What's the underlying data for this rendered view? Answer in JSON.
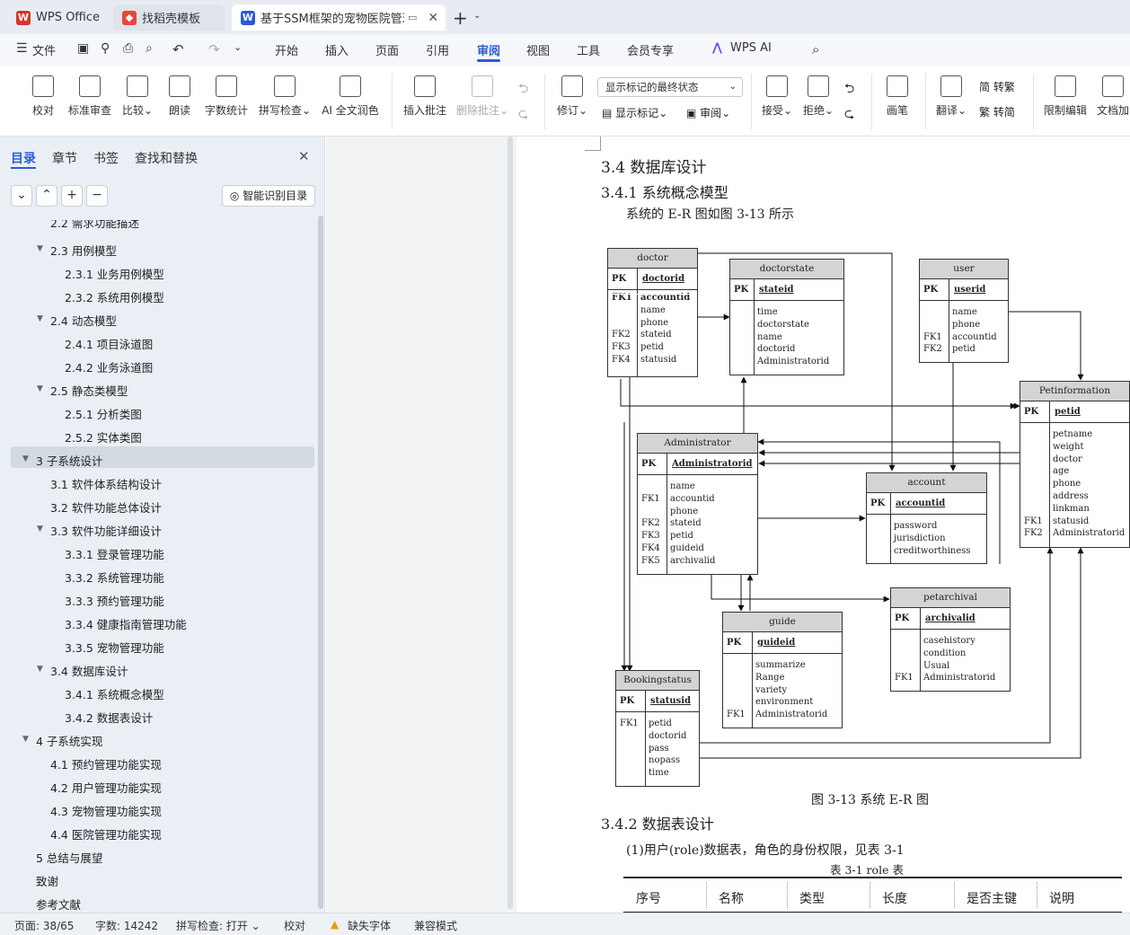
{
  "tabs": [
    {
      "label": "WPS Office"
    },
    {
      "label": "找稻壳模板"
    },
    {
      "label": "基于SSM框架的宠物医院管理"
    }
  ],
  "menu": [
    "文件",
    "开始",
    "插入",
    "页面",
    "引用",
    "审阅",
    "视图",
    "工具",
    "会员专享",
    "WPS AI"
  ],
  "active_menu": "审阅",
  "ribbon": {
    "proofread": "校对",
    "std_review": "标准审查",
    "compare": "比较",
    "read_aloud": "朗读",
    "word_count": "字数统计",
    "spell": "拼写检查",
    "ai_polish": "AI 全文润色",
    "insert_comment": "插入批注",
    "delete_comment": "删除批注",
    "track": "修订",
    "show_mode": "显示标记的最终状态",
    "show_marks": "显示标记",
    "review": "审阅",
    "accept": "接受",
    "reject": "拒绝",
    "pen": "画笔",
    "translate": "翻译",
    "to_trad": "简 转繁",
    "to_simp": "繁 转简",
    "restrict": "限制编辑",
    "doc_enc": "文档加"
  },
  "nav": {
    "tabs": [
      "目录",
      "章节",
      "书签",
      "查找和替换"
    ],
    "smart_btn": "智能识别目录",
    "items": [
      {
        "text": "2.2  需求功能描述",
        "level": 1
      },
      {
        "text": "2.3  用例模型",
        "level": 1,
        "expand": true
      },
      {
        "text": "2.3.1  业务用例模型",
        "level": 2
      },
      {
        "text": "2.3.2  系统用例模型",
        "level": 2
      },
      {
        "text": "2.4  动态模型",
        "level": 1,
        "expand": true
      },
      {
        "text": "2.4.1  项目泳道图",
        "level": 2
      },
      {
        "text": "2.4.2  业务泳道图",
        "level": 2
      },
      {
        "text": "2.5  静态类模型",
        "level": 1,
        "expand": true
      },
      {
        "text": "2.5.1  分析类图",
        "level": 2
      },
      {
        "text": "2.5.2  实体类图",
        "level": 2
      },
      {
        "text": "3  子系统设计",
        "level": 0,
        "expand": true,
        "selected": true
      },
      {
        "text": "3.1  软件体系结构设计",
        "level": 1
      },
      {
        "text": "3.2  软件功能总体设计",
        "level": 1
      },
      {
        "text": "3.3  软件功能详细设计",
        "level": 1,
        "expand": true
      },
      {
        "text": "3.3.1  登录管理功能",
        "level": 2
      },
      {
        "text": "3.3.2  系统管理功能",
        "level": 2
      },
      {
        "text": "3.3.3  预约管理功能",
        "level": 2
      },
      {
        "text": "3.3.4  健康指南管理功能",
        "level": 2
      },
      {
        "text": "3.3.5  宠物管理功能",
        "level": 2
      },
      {
        "text": "3.4  数据库设计",
        "level": 1,
        "expand": true
      },
      {
        "text": "3.4.1  系统概念模型",
        "level": 2
      },
      {
        "text": "3.4.2  数据表设计",
        "level": 2
      },
      {
        "text": "4  子系统实现",
        "level": 0,
        "expand": true
      },
      {
        "text": "4.1  预约管理功能实现",
        "level": 1
      },
      {
        "text": "4.2  用户管理功能实现",
        "level": 1
      },
      {
        "text": "4.3  宠物管理功能实现",
        "level": 1
      },
      {
        "text": "4.4  医院管理功能实现",
        "level": 1
      },
      {
        "text": "5  总结与展望",
        "level": 0
      },
      {
        "text": "致谢",
        "level": 0
      },
      {
        "text": "参考文献",
        "level": 0
      }
    ]
  },
  "doc": {
    "h1": "3.4  数据库设计",
    "h2a": "3.4.1  系统概念模型",
    "intro": "系统的 E-R 图如图 3-13 所示",
    "caption": "图 3-13 系统 E-R 图",
    "h2b": "3.4.2  数据表设计",
    "para": "(1)用户(role)数据表，角色的身份权限，见表 3-1",
    "table_title": "表 3-1 role 表",
    "table_headers": [
      "序号",
      "名称",
      "类型",
      "长度",
      "是否主键",
      "说明"
    ]
  },
  "er": {
    "doctor": {
      "title": "doctor",
      "pk": "doctorid",
      "fk": [
        "FK1",
        "",
        "",
        "FK2",
        "FK3",
        "FK4"
      ],
      "fields": [
        "accountid",
        "name",
        "phone",
        "stateid",
        "petid",
        "statusid"
      ]
    },
    "doctorstate": {
      "title": "doctorstate",
      "pk": "stateid",
      "fk": [],
      "fields": [
        "time",
        "doctorstate",
        "name",
        "doctorid",
        "Administratorid"
      ]
    },
    "user": {
      "title": "user",
      "pk": "userid",
      "fk": [
        "",
        "",
        "FK1",
        "FK2"
      ],
      "fields": [
        "name",
        "phone",
        "accountid",
        "petid"
      ]
    },
    "petinformation": {
      "title": "Petinformation",
      "pk": "petid",
      "fk": [
        "",
        "",
        "",
        "",
        "",
        "",
        "",
        "FK1",
        "FK2"
      ],
      "fields": [
        "petname",
        "weight",
        "doctor",
        "age",
        "phone",
        "address",
        "linkman",
        "statusid",
        "Administratorid"
      ]
    },
    "administrator": {
      "title": "Administrator",
      "pk": "Administratorid",
      "fk": [
        "",
        "FK1",
        "",
        "FK2",
        "FK3",
        "FK4",
        "FK5"
      ],
      "fields": [
        "name",
        "accountid",
        "phone",
        "stateid",
        "petid",
        "guideid",
        "archivalid"
      ]
    },
    "account": {
      "title": "account",
      "pk": "accountid",
      "fk": [],
      "fields": [
        "password",
        "jurisdiction",
        "creditworthiness"
      ]
    },
    "petarchival": {
      "title": "petarchival",
      "pk": "archivalid",
      "fk": [
        "",
        "",
        "",
        "FK1"
      ],
      "fields": [
        "casehistory",
        "condition",
        "Usual",
        "Administratorid"
      ]
    },
    "guide": {
      "title": "guide",
      "pk": "guideid",
      "fk": [
        "",
        "",
        "",
        "",
        "FK1"
      ],
      "fields": [
        "summarize",
        "Range",
        "variety",
        "environment",
        "Administratorid"
      ]
    },
    "bookingstatus": {
      "title": "Bookingstatus",
      "pk": "statusid",
      "fk": [
        "FK1",
        "",
        "",
        "",
        ""
      ],
      "fields": [
        "petid",
        "doctorid",
        "pass",
        "nopass",
        "time"
      ]
    }
  },
  "status": {
    "page": "页面: 38/65",
    "words": "字数: 14242",
    "spell": "拼写检查: 打开",
    "proof": "校对",
    "missing_font": "缺失字体",
    "compat": "兼容模式"
  },
  "colors": {
    "accent": "#2b5cd6",
    "wps_red": "#d9342b",
    "word_blue": "#2a5ad8"
  }
}
